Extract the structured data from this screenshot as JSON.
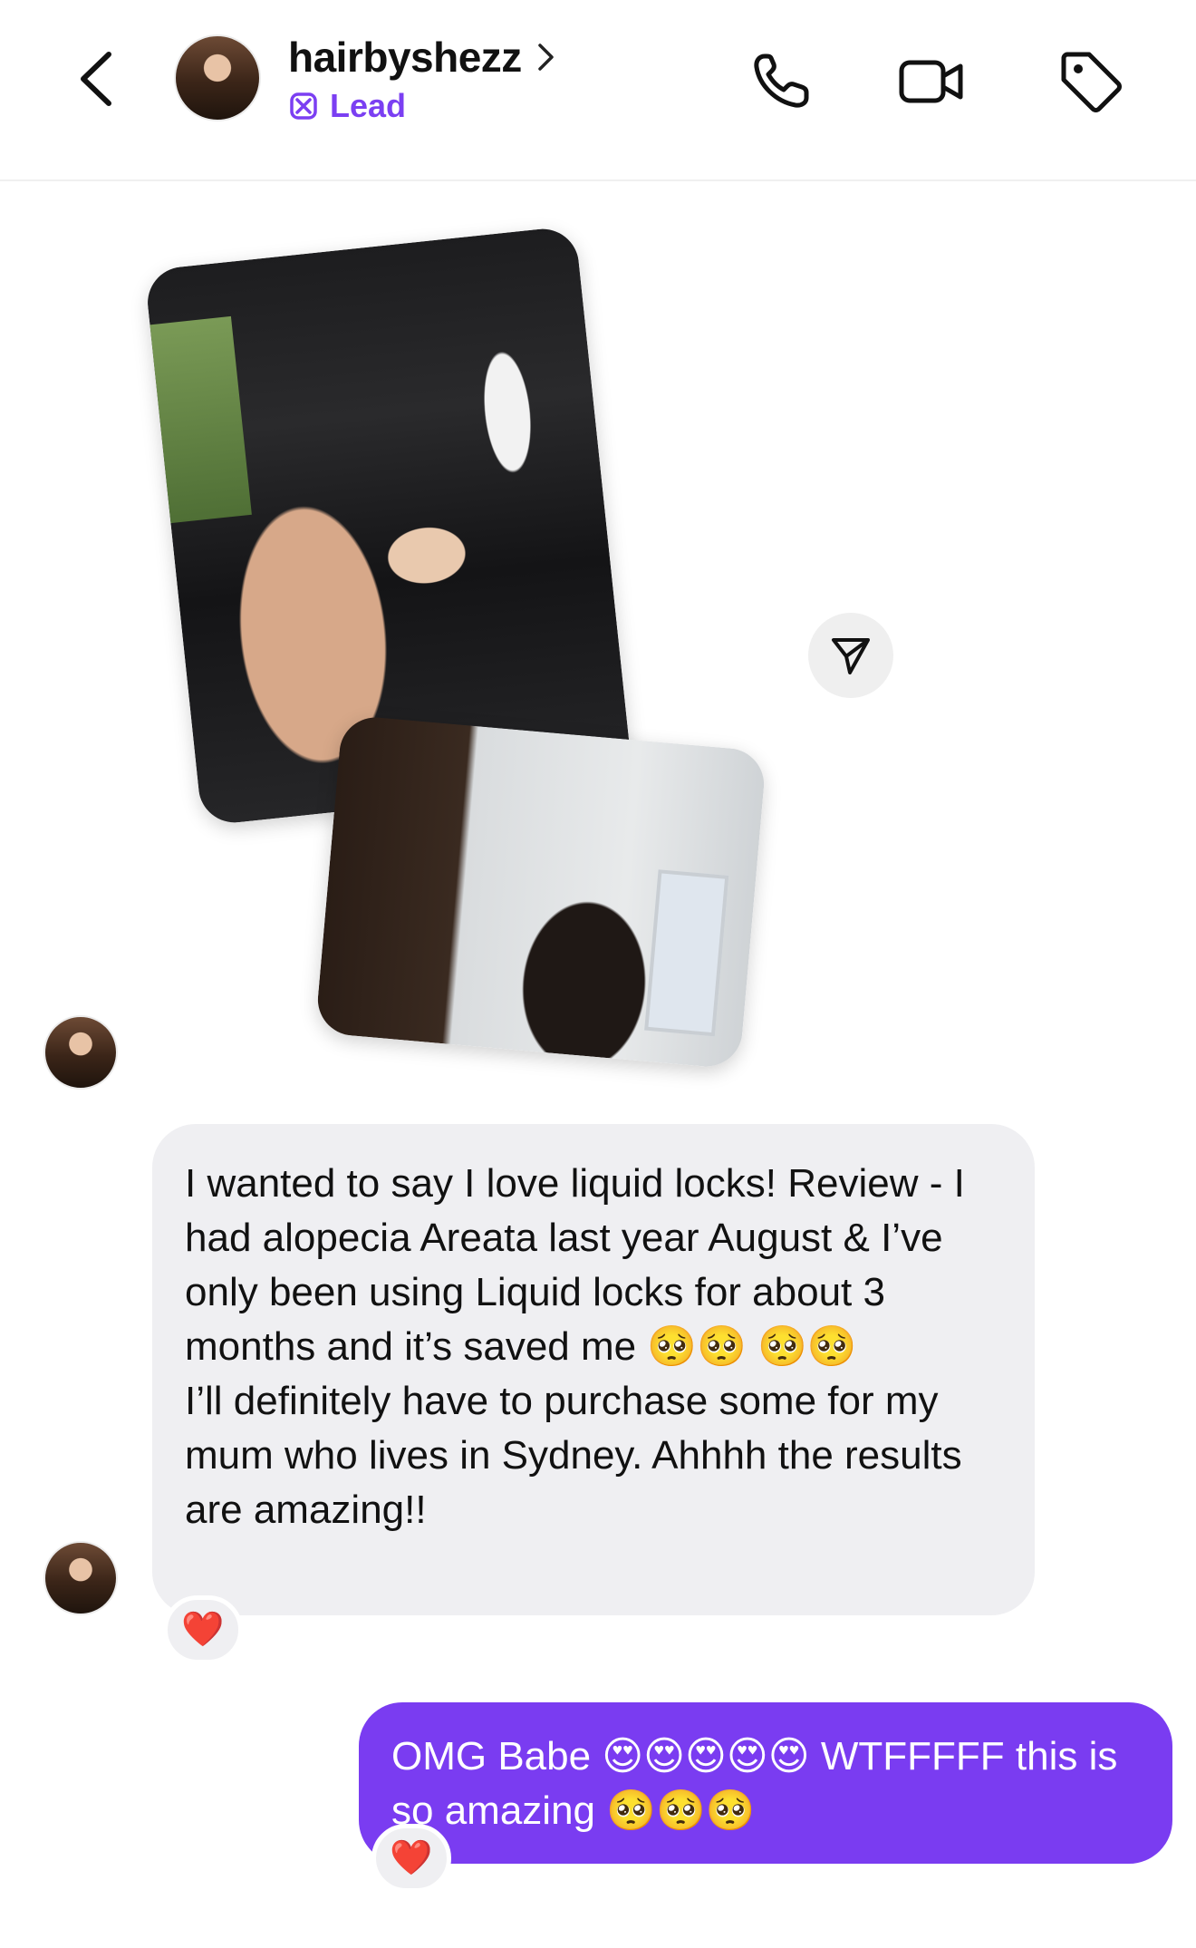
{
  "header": {
    "username": "hairbyshezz",
    "lead_label": "Lead",
    "icons": {
      "back": "chevron-left-icon",
      "profile_chevron": "chevron-right-icon",
      "lead": "lead-badge-icon",
      "call": "phone-icon",
      "video": "video-camera-icon",
      "tag": "tag-icon"
    },
    "accent_color": "#7b3ff2"
  },
  "media": {
    "photos": [
      "photo-1",
      "photo-2"
    ],
    "share_icon": "share-icon"
  },
  "messages": [
    {
      "direction": "incoming",
      "text": "I wanted to say I love liquid locks! Review - I had alopecia Areata last year August & I’ve only been using Liquid locks for about 3 months and it’s saved me 🥺🥺 🥺🥺\nI’ll definitely have to purchase some for my mum who lives in Sydney. Ahhhh the results are amazing!!",
      "reaction": "❤️"
    },
    {
      "direction": "outgoing",
      "text": "OMG Babe 😍😍😍😍😍 WTFFFFF this is so amazing 🥺🥺🥺",
      "reaction": "❤️",
      "bubble_color": "#7a3cf1"
    }
  ]
}
